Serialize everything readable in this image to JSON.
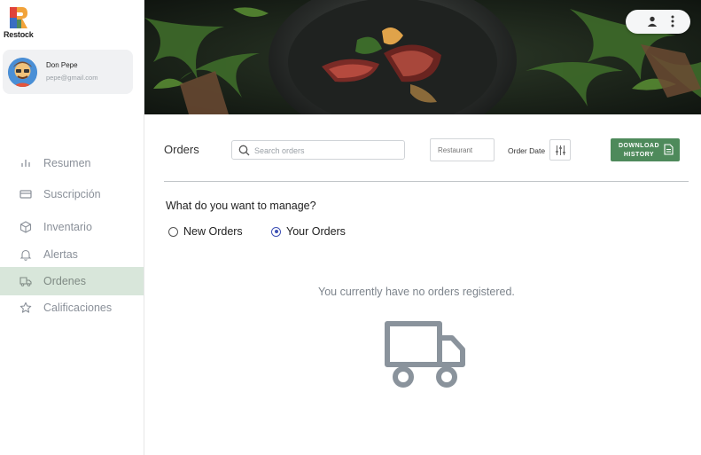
{
  "brand": {
    "name": "Restock"
  },
  "profile": {
    "name": "Don Pepe",
    "email": "pepe@gmail.com"
  },
  "sidebar": {
    "items": [
      {
        "label": "Resumen",
        "icon": "bar-chart-icon"
      },
      {
        "label": "Suscripción",
        "icon": "credit-card-icon"
      },
      {
        "label": "Inventario",
        "icon": "box-icon"
      },
      {
        "label": "Alertas",
        "icon": "bell-icon"
      },
      {
        "label": "Ordenes",
        "icon": "truck-icon",
        "active": true
      },
      {
        "label": "Calificaciones",
        "icon": "star-icon"
      }
    ]
  },
  "toolbar": {
    "title": "Orders",
    "search_placeholder": "Search orders",
    "restaurant_placeholder": "Restaurant",
    "order_date_label": "Order Date",
    "download_label_line1": "DOWNLOAD",
    "download_label_line2": "HISTORY"
  },
  "manage": {
    "question": "What do you want to manage?",
    "options": [
      {
        "label": "New Orders",
        "checked": false
      },
      {
        "label": "Your Orders",
        "checked": true
      }
    ]
  },
  "empty_state": {
    "message": "You currently have no orders registered."
  },
  "colors": {
    "accent_green": "#4e8a5b",
    "active_nav_bg": "#d8e6da",
    "radio_blue": "#3f51b5"
  }
}
